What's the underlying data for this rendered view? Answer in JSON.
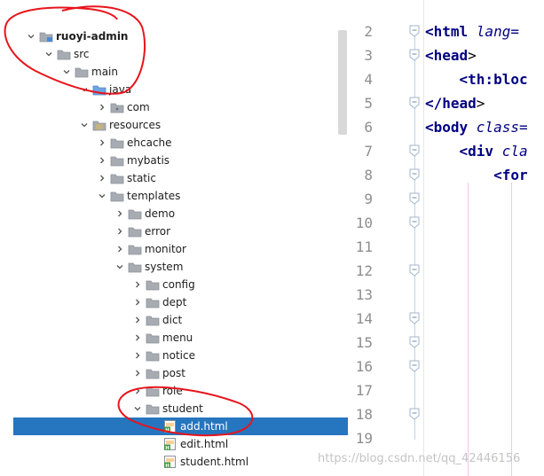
{
  "tree": {
    "items": [
      {
        "label": "ruoyi-admin",
        "icon": "module-folder-icon",
        "chevron": "down",
        "bold": true
      },
      {
        "label": "src",
        "icon": "folder-icon",
        "chevron": "down"
      },
      {
        "label": "main",
        "icon": "folder-icon",
        "chevron": "down"
      },
      {
        "label": "java",
        "icon": "source-folder-icon",
        "chevron": "down"
      },
      {
        "label": "com",
        "icon": "package-icon",
        "chevron": "right"
      },
      {
        "label": "resources",
        "icon": "resources-folder-icon",
        "chevron": "down"
      },
      {
        "label": "ehcache",
        "icon": "folder-icon",
        "chevron": "right"
      },
      {
        "label": "mybatis",
        "icon": "folder-icon",
        "chevron": "right"
      },
      {
        "label": "static",
        "icon": "folder-icon",
        "chevron": "right"
      },
      {
        "label": "templates",
        "icon": "folder-icon",
        "chevron": "down"
      },
      {
        "label": "demo",
        "icon": "folder-icon",
        "chevron": "right"
      },
      {
        "label": "error",
        "icon": "folder-icon",
        "chevron": "right"
      },
      {
        "label": "monitor",
        "icon": "folder-icon",
        "chevron": "right"
      },
      {
        "label": "system",
        "icon": "folder-icon",
        "chevron": "down"
      },
      {
        "label": "config",
        "icon": "folder-icon",
        "chevron": "right"
      },
      {
        "label": "dept",
        "icon": "folder-icon",
        "chevron": "right"
      },
      {
        "label": "dict",
        "icon": "folder-icon",
        "chevron": "right"
      },
      {
        "label": "menu",
        "icon": "folder-icon",
        "chevron": "right"
      },
      {
        "label": "notice",
        "icon": "folder-icon",
        "chevron": "right"
      },
      {
        "label": "post",
        "icon": "folder-icon",
        "chevron": "right"
      },
      {
        "label": "role",
        "icon": "folder-icon",
        "chevron": "right"
      },
      {
        "label": "student",
        "icon": "folder-icon",
        "chevron": "down"
      },
      {
        "label": "add.html",
        "icon": "html-file-icon",
        "chevron": "none",
        "selected": true
      },
      {
        "label": "edit.html",
        "icon": "html-file-icon",
        "chevron": "none"
      },
      {
        "label": "student.html",
        "icon": "html-file-icon",
        "chevron": "none"
      }
    ]
  },
  "editor": {
    "lines": [
      {
        "num": "2",
        "code": [
          [
            "tag",
            "<html "
          ],
          [
            "attr",
            "lang="
          ]
        ]
      },
      {
        "num": "3",
        "code": [
          [
            "tag",
            "<head"
          ],
          [
            "punct",
            ">"
          ]
        ]
      },
      {
        "num": "4",
        "code": [
          [
            "tag",
            "    <th:bloc"
          ]
        ]
      },
      {
        "num": "5",
        "code": [
          [
            "tag",
            "</head"
          ],
          [
            "punct",
            ">"
          ]
        ]
      },
      {
        "num": "6",
        "code": [
          [
            "tag",
            "<body "
          ],
          [
            "attr",
            "class="
          ]
        ]
      },
      {
        "num": "7",
        "code": [
          [
            "tag",
            "    <div "
          ],
          [
            "attr",
            "cla"
          ]
        ]
      },
      {
        "num": "8",
        "code": [
          [
            "tag",
            "        <for"
          ]
        ]
      },
      {
        "num": "9",
        "code": []
      },
      {
        "num": "10",
        "code": []
      },
      {
        "num": "11",
        "code": []
      },
      {
        "num": "12",
        "code": []
      },
      {
        "num": "13",
        "code": []
      },
      {
        "num": "14",
        "code": []
      },
      {
        "num": "15",
        "code": []
      },
      {
        "num": "16",
        "code": []
      },
      {
        "num": "17",
        "code": []
      },
      {
        "num": "18",
        "code": []
      },
      {
        "num": "19",
        "code": []
      }
    ]
  },
  "watermark": "https://blog.csdn.net/qq_42446156",
  "colors": {
    "selection": "#2675bf",
    "annotation": "#e8141b",
    "tag": "#000080"
  }
}
